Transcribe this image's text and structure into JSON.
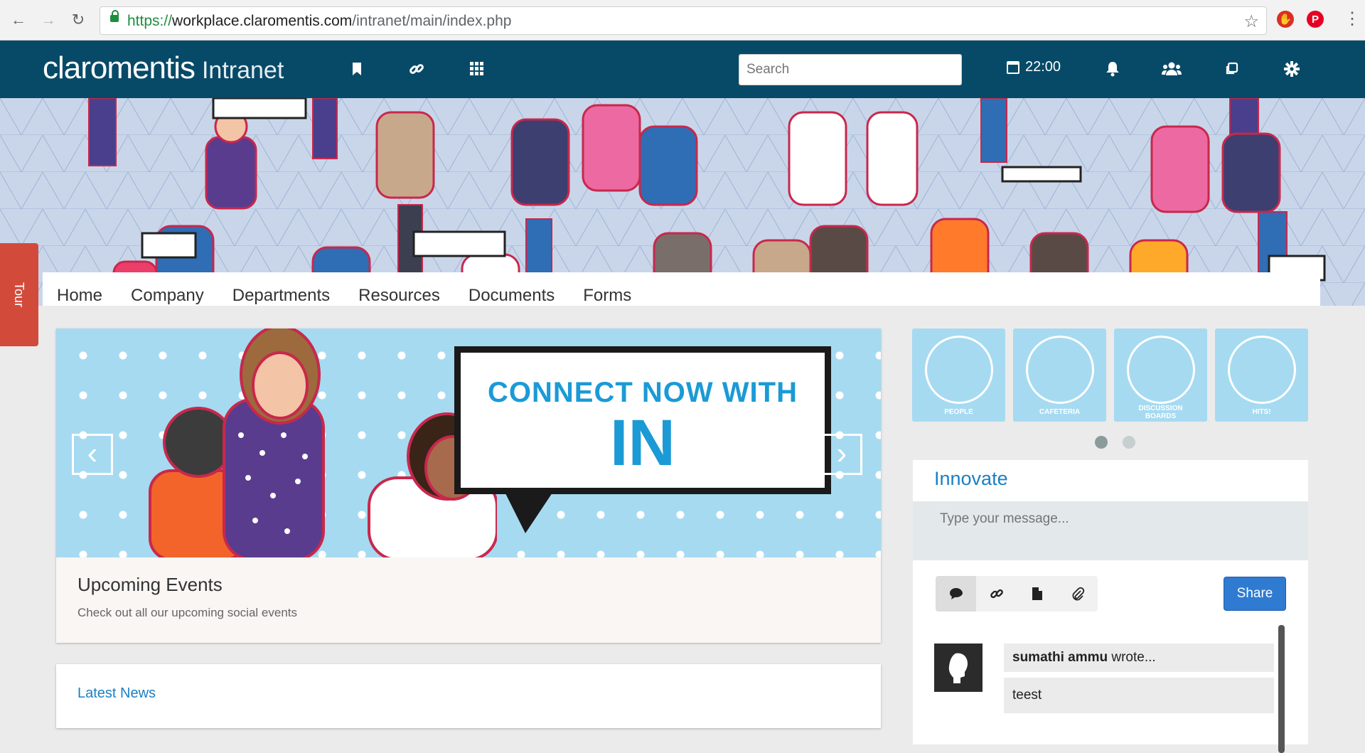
{
  "browser": {
    "url_scheme": "https://",
    "url_domain": "workplace.claromentis.com",
    "url_path": "/intranet/main/index.php"
  },
  "header": {
    "brand": "claromentis",
    "product": "Intranet",
    "search_placeholder": "Search",
    "time": "22:00"
  },
  "nav": {
    "items": [
      "Home",
      "Company",
      "Departments",
      "Resources",
      "Documents",
      "Forms"
    ]
  },
  "tour_label": "Tour",
  "carousel": {
    "banner_line1": "CONNECT NOW WITH",
    "banner_line2": "IN",
    "title": "Upcoming Events",
    "description": "Check out all our upcoming social events"
  },
  "latest_news": {
    "title": "Latest News"
  },
  "tiles": [
    {
      "label": "PEOPLE"
    },
    {
      "label": "CAFETERIA"
    },
    {
      "label": "DISCUSSION BOARDS"
    },
    {
      "label": "HITS!"
    }
  ],
  "innovate": {
    "title": "Innovate",
    "placeholder": "Type your message...",
    "share_label": "Share",
    "post": {
      "author": "sumathi ammu",
      "verb": "wrote...",
      "body": "teest"
    }
  },
  "colors": {
    "header_bg": "#074a68",
    "accent_blue": "#1b7fc4",
    "share_button": "#2f7bd1",
    "tour_tab": "#d24b3a",
    "tile_bg": "#a6daf1"
  }
}
